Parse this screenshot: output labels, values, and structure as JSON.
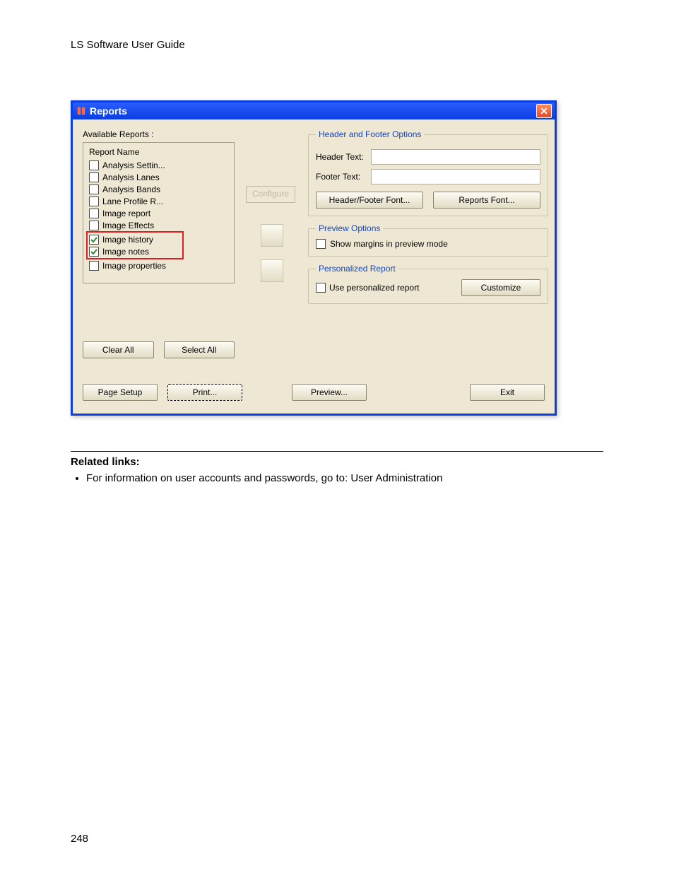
{
  "doc": {
    "header": "LS Software User Guide",
    "page_number": "248",
    "related_title": "Related links:",
    "related_item": "For information on user accounts and passwords, go to: User Administration"
  },
  "window": {
    "title": "Reports",
    "close_x": "✕",
    "available_reports_label": "Available Reports :",
    "list_header": "Report Name",
    "items": [
      {
        "label": "Analysis Settin...",
        "checked": false
      },
      {
        "label": "Analysis Lanes",
        "checked": false
      },
      {
        "label": "Analysis Bands",
        "checked": false
      },
      {
        "label": "Lane Profile R...",
        "checked": false
      },
      {
        "label": "Image report",
        "checked": false
      },
      {
        "label": "Image Effects",
        "checked": false
      },
      {
        "label": "Image history",
        "checked": true
      },
      {
        "label": "Image notes",
        "checked": true
      },
      {
        "label": "Image properties",
        "checked": false
      }
    ],
    "configure_btn": "Configure",
    "clear_all": "Clear All",
    "select_all": "Select All",
    "page_setup": "Page Setup",
    "print": "Print...",
    "preview": "Preview...",
    "exit": "Exit",
    "hf_options": {
      "legend": "Header and Footer Options",
      "header_label": "Header Text:",
      "footer_label": "Footer Text:",
      "hf_font_btn": "Header/Footer Font...",
      "reports_font_btn": "Reports Font..."
    },
    "preview_options": {
      "legend": "Preview Options",
      "show_margins": "Show margins in preview mode"
    },
    "personalized": {
      "legend": "Personalized Report",
      "use_personalized": "Use personalized report",
      "customize": "Customize"
    }
  }
}
